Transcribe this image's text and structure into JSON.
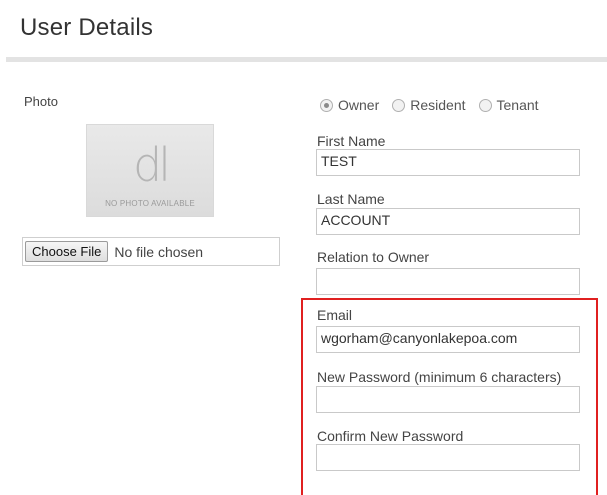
{
  "header": {
    "title": "User Details"
  },
  "photo": {
    "label": "Photo",
    "placeholder_logo": "dl",
    "placeholder_caption": "NO PHOTO AVAILABLE",
    "choose_button": "Choose File",
    "file_status": "No file chosen"
  },
  "user_type": {
    "options": [
      "Owner",
      "Resident",
      "Tenant"
    ],
    "selected": "Owner"
  },
  "form": {
    "first_name": {
      "label": "First Name",
      "value": "TEST"
    },
    "last_name": {
      "label": "Last Name",
      "value": "ACCOUNT"
    },
    "relation": {
      "label": "Relation to Owner",
      "value": ""
    },
    "email": {
      "label": "Email",
      "value": "wgorham@canyonlakepoa.com"
    },
    "new_password": {
      "label": "New Password (minimum 6 characters)",
      "value": ""
    },
    "confirm_password": {
      "label": "Confirm New Password",
      "value": ""
    }
  },
  "colors": {
    "highlight": "#e02020",
    "rule": "#e3e3e3"
  }
}
